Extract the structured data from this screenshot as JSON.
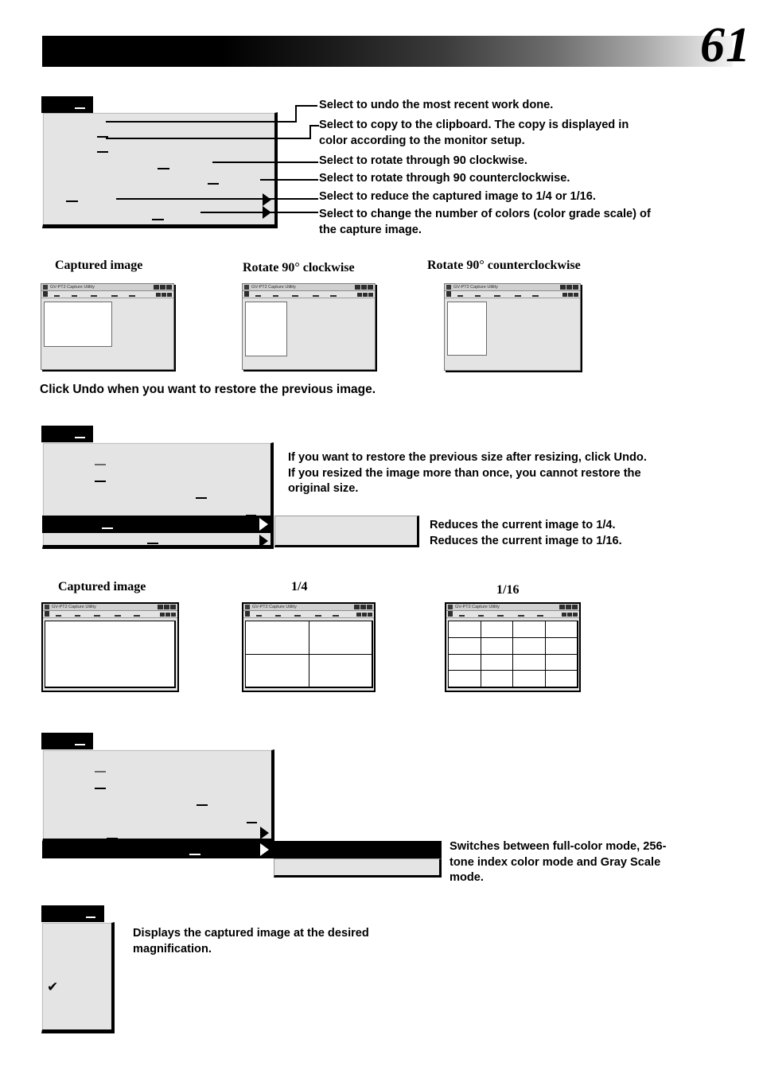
{
  "page": {
    "number": "61",
    "header_gradient_from": "#000000",
    "header_gradient_to": "#ffffff"
  },
  "section_edit": {
    "menu_title_label": "",
    "callouts": [
      "Select to undo the most recent work done.",
      "Select to copy to the clipboard.  The copy is displayed in\ncolor according to the monitor setup.",
      "Select to rotate through 90   clockwise.",
      "Select to rotate through 90   counterclockwise.",
      "Select to reduce the captured image to 1/4 or 1/16.",
      "Select to change the number of colors (color grade scale) of\nthe capture image."
    ]
  },
  "rotate_examples": {
    "captions": [
      "Captured image",
      "Rotate 90° clockwise",
      "Rotate 90° counterclockwise"
    ],
    "window_title": "GV-PT2 Capture Utility",
    "note": "Click Undo when you want to restore the previous image."
  },
  "section_resize": {
    "menu_title_label": "",
    "note": "If you want to restore the previous size after resizing, click Undo.\nIf you resized the image more than once, you cannot restore the\noriginal size.",
    "submenu_callouts": [
      "Reduces the current image to 1/4.",
      "Reduces the current image to 1/16."
    ]
  },
  "resize_examples": {
    "captions": [
      "Captured image",
      "1/4",
      "1/16"
    ],
    "window_title": "GV-PT2 Capture Utility",
    "grids": [
      {
        "cols": 1,
        "rows": 1
      },
      {
        "cols": 2,
        "rows": 2
      },
      {
        "cols": 4,
        "rows": 4
      }
    ]
  },
  "section_color": {
    "menu_title_label": "",
    "callout": "Switches between full-color mode, 256-\ntone index color mode and Gray Scale\nmode."
  },
  "section_zoom": {
    "menu_title_label": "",
    "callout": "Displays the captured image at the desired\nmagnification.",
    "check_glyph": "✔"
  }
}
